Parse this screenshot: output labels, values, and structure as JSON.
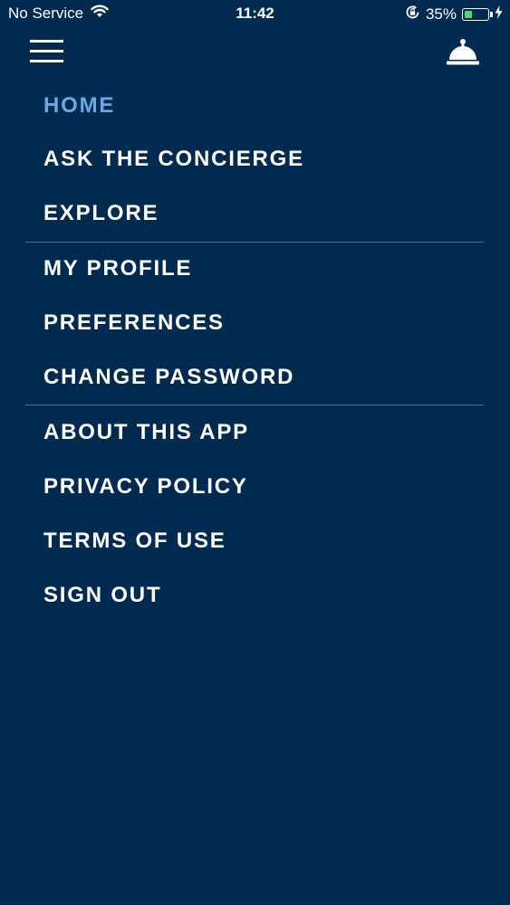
{
  "status_bar": {
    "carrier": "No Service",
    "time": "11:42",
    "battery_percent": "35%",
    "battery_level": 0.35,
    "icons": [
      "wifi-icon",
      "orientation-lock-icon",
      "battery-icon",
      "charging-bolt-icon"
    ]
  },
  "header": {
    "menu_icon": "hamburger-icon",
    "concierge_icon": "service-bell-icon"
  },
  "menu": {
    "groups": [
      {
        "items": [
          {
            "label": "HOME",
            "active": true
          },
          {
            "label": "ASK THE CONCIERGE",
            "active": false
          },
          {
            "label": "EXPLORE",
            "active": false
          }
        ]
      },
      {
        "items": [
          {
            "label": "MY PROFILE",
            "active": false
          },
          {
            "label": "PREFERENCES",
            "active": false
          },
          {
            "label": "CHANGE PASSWORD",
            "active": false
          }
        ]
      },
      {
        "items": [
          {
            "label": "ABOUT THIS APP",
            "active": false
          },
          {
            "label": "PRIVACY POLICY",
            "active": false
          },
          {
            "label": "TERMS OF USE",
            "active": false
          },
          {
            "label": "SIGN OUT",
            "active": false
          }
        ]
      }
    ]
  },
  "colors": {
    "background": "#002a50",
    "text": "#ffffff",
    "active_item": "#6aa8e6",
    "divider": "#4f7293",
    "battery_fill": "#4cd964"
  }
}
